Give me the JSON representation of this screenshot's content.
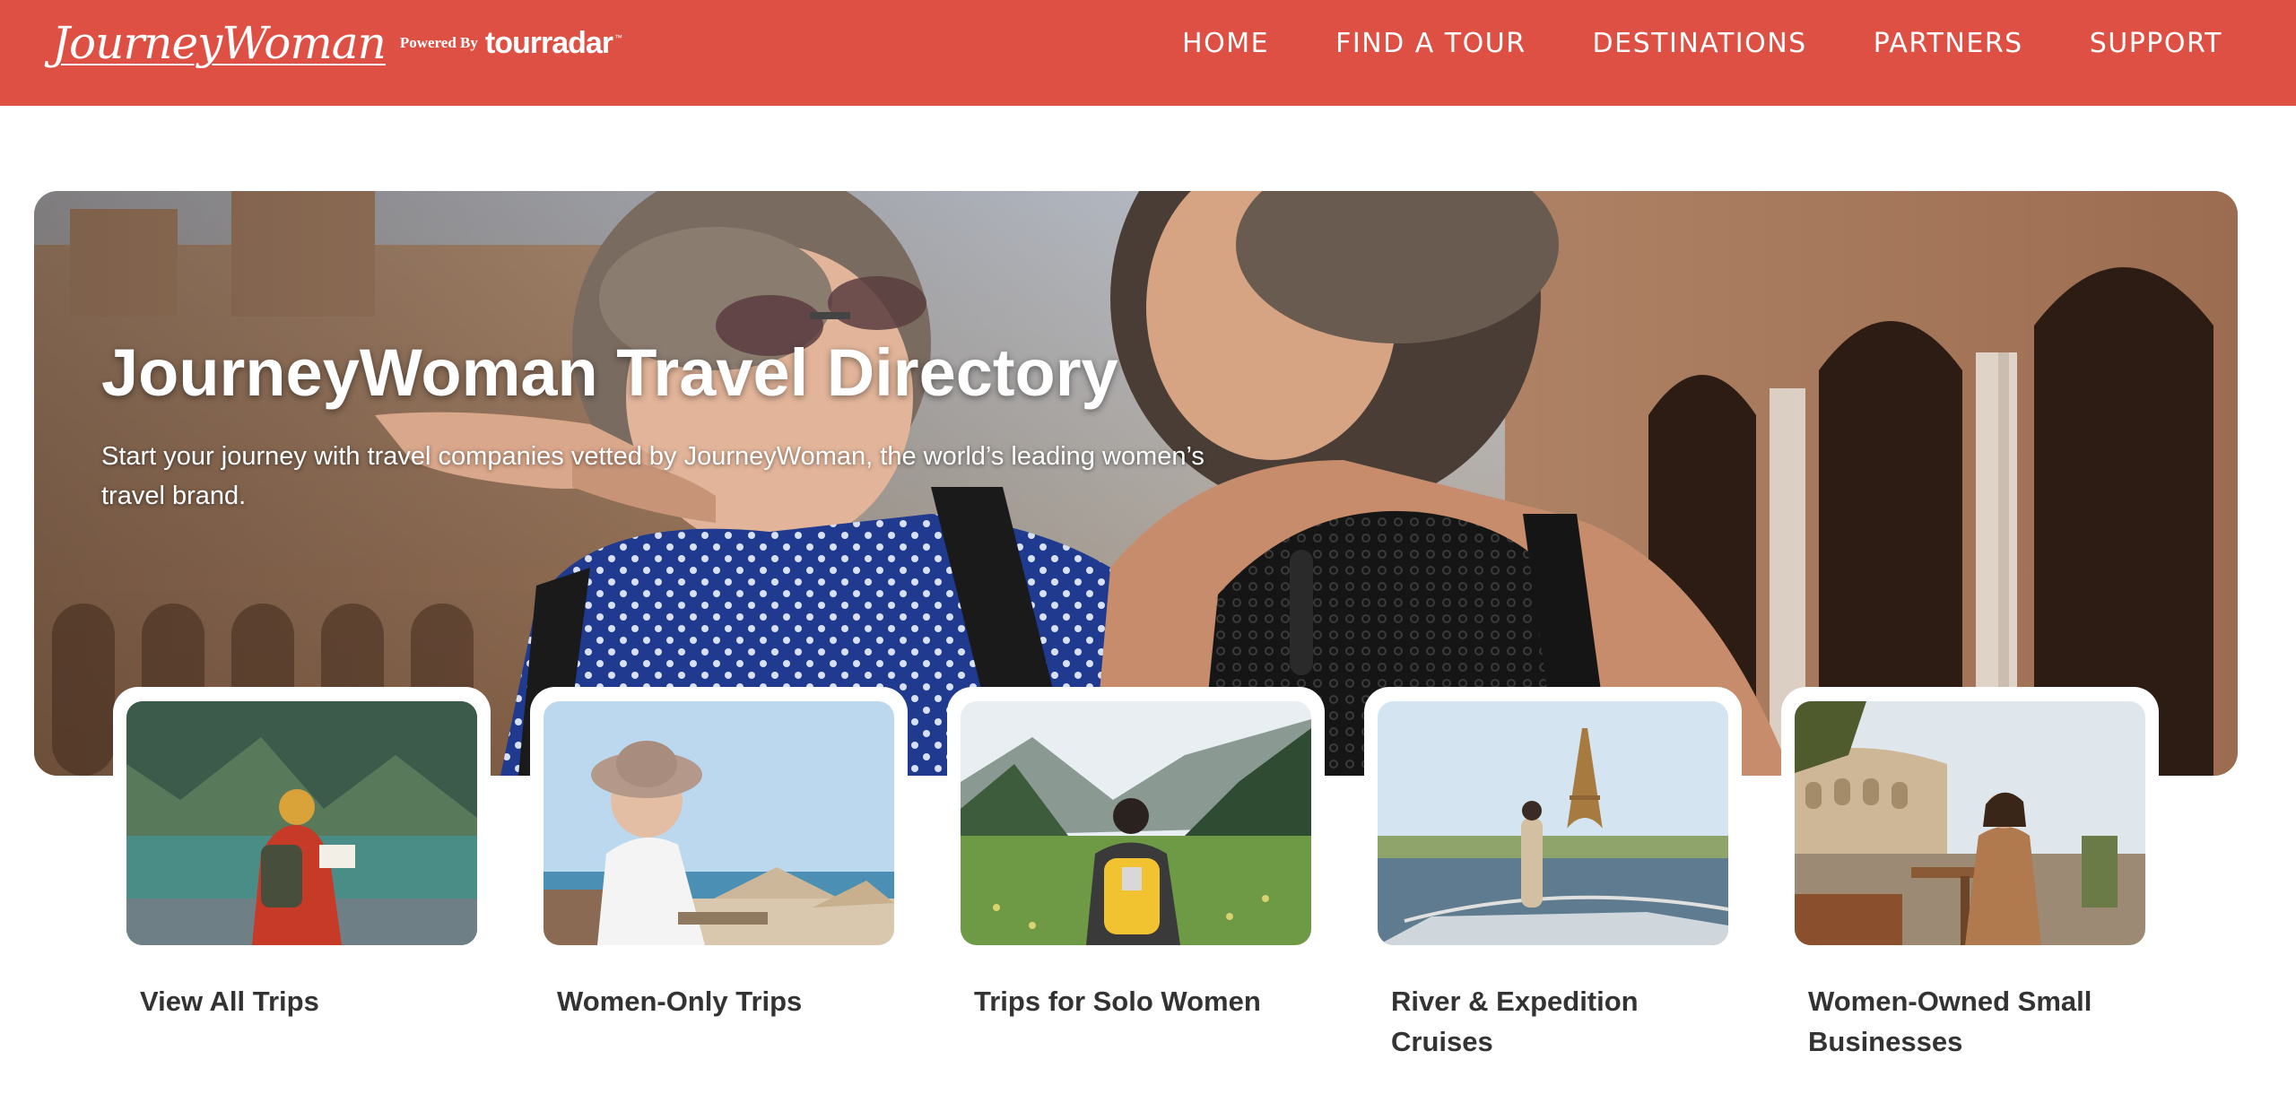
{
  "header": {
    "logo_text": "JourneyWoman",
    "powered_by": "Powered By",
    "partner_logo": "tourradar",
    "trademark": "™",
    "nav": [
      {
        "label": "HOME"
      },
      {
        "label": "FIND A TOUR"
      },
      {
        "label": "DESTINATIONS"
      },
      {
        "label": "PARTNERS"
      },
      {
        "label": "SUPPORT"
      }
    ]
  },
  "hero": {
    "title": "JourneyWoman Travel Directory",
    "subtitle": "Start your journey with travel companies vetted by JourneyWoman, the world’s leading women’s travel brand."
  },
  "categories": [
    {
      "label": "View All Trips",
      "image": "hiker-at-mountain-lake"
    },
    {
      "label": "Women-Only Trips",
      "image": "woman-in-sunhat-at-beach"
    },
    {
      "label": "Trips for Solo Women",
      "image": "backpacker-in-green-valley"
    },
    {
      "label": "River & Expedition Cruises",
      "image": "eiffel-tower-river-cruise"
    },
    {
      "label": "Women-Owned Small Businesses",
      "image": "woman-at-cafe-near-colosseum"
    }
  ],
  "colors": {
    "brand_red": "#de5044",
    "text_dark": "#333333",
    "white": "#ffffff"
  }
}
